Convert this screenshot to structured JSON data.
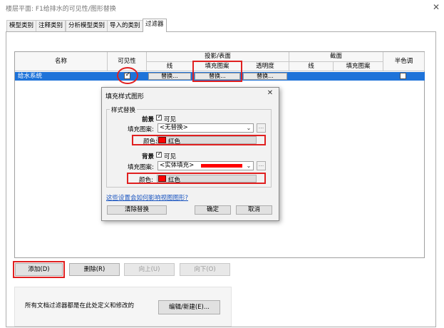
{
  "window": {
    "title": "楼层平面: F1给排水的可见性/图形替换"
  },
  "tabs": [
    {
      "label": "模型类别"
    },
    {
      "label": "注释类别"
    },
    {
      "label": "分析模型类别"
    },
    {
      "label": "导入的类别"
    },
    {
      "label": "过滤器"
    }
  ],
  "grid": {
    "headers": {
      "name": "名称",
      "visibility": "可见性",
      "projection_surface": "投影/表面",
      "lines": "线",
      "fill_pattern": "填充图案",
      "transparency": "透明度",
      "cut": "截面",
      "cut_lines": "线",
      "cut_fill_pattern": "填充图案",
      "halftone": "半色调"
    },
    "rows": [
      {
        "name": "给水系统",
        "visible": true,
        "lines_btn": "替换...",
        "fill_btn": "替换...",
        "transparency_btn": "替换...",
        "halftone": false
      }
    ]
  },
  "dialog": {
    "title": "填充样式图形",
    "group_title": "样式替换",
    "foreground": {
      "label": "前景",
      "visible_label": "可见",
      "fill_pattern_label": "填充图案:",
      "fill_pattern_value": "<无替换>",
      "color_label": "颜色:",
      "color_value": "红色",
      "color_hex": "#ff0000"
    },
    "background": {
      "label": "背景",
      "visible_label": "可见",
      "fill_pattern_label": "填充图案:",
      "fill_pattern_value": "<实体填充>",
      "color_label": "颜色:",
      "color_value": "红色",
      "color_hex": "#ff0000"
    },
    "ellipsis": "...",
    "link_text": "这些设置会如何影响视图图形?",
    "clear_button": "清除替换",
    "ok_button": "确定",
    "cancel_button": "取消"
  },
  "actions": {
    "add": "添加(D)",
    "delete": "删除(R)",
    "up": "向上(U)",
    "down": "向下(O)"
  },
  "bottom": {
    "note": "所有文档过滤器都是在此处定义和修改的",
    "edit_button": "编辑/新建(E)..."
  },
  "colors": {
    "highlight_red": "#e02020",
    "selection_blue": "#1e73d9",
    "swatch_red": "#ff0000"
  }
}
